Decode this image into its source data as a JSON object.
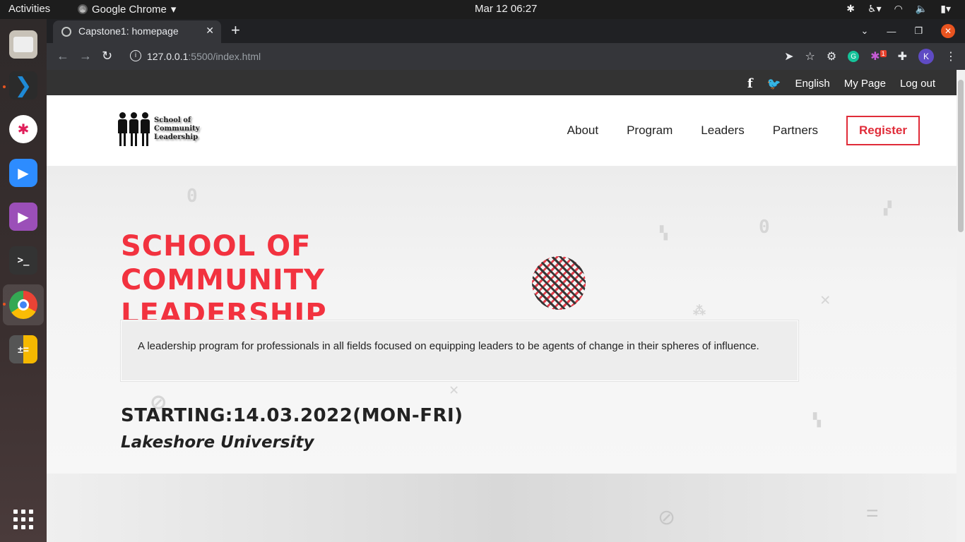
{
  "system": {
    "activities": "Activities",
    "app_name": "Google Chrome",
    "clock": "Mar 12  06:27"
  },
  "browser": {
    "tab_title": "Capstone1: homepage",
    "url_host": "127.0.0.1",
    "url_rest": ":5500/index.html",
    "new_tab": "+",
    "avatar_letter": "K",
    "ext_badge": "1"
  },
  "social_bar": {
    "facebook": "f",
    "language": "English",
    "my_page": "My Page",
    "logout": "Log out"
  },
  "header": {
    "logo_text": "School of Community Leadership",
    "nav": [
      "About",
      "Program",
      "Leaders",
      "Partners"
    ],
    "register": "Register"
  },
  "hero": {
    "title": "SCHOOL OF COMMUNITY LEADERSHIP",
    "description": "A leadership program for professionals in all fields focused on equipping leaders to be agents of change in their spheres of influence.",
    "starting": "STARTING:14.03.2022(MON-FRI)",
    "venue": "Lakeshore University"
  },
  "colors": {
    "accent": "#f2323f",
    "topbar": "#333333"
  }
}
